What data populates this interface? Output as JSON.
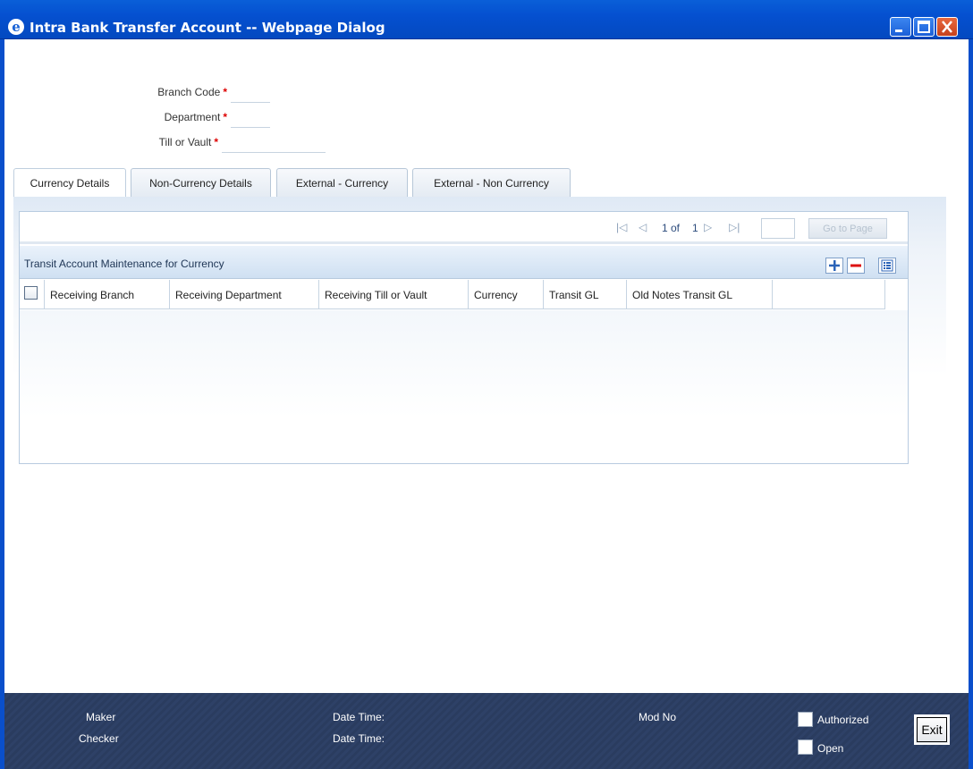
{
  "window": {
    "title": "Intra Bank Transfer Account -- Webpage Dialog"
  },
  "form": {
    "branch_code": {
      "label": "Branch Code",
      "required_mark": "*",
      "value": ""
    },
    "department": {
      "label": "Department",
      "required_mark": "*",
      "value": ""
    },
    "till_or_vault": {
      "label": "Till or Vault",
      "required_mark": "*",
      "value": ""
    }
  },
  "tabs": [
    {
      "label": "Currency Details",
      "active": true
    },
    {
      "label": "Non-Currency Details",
      "active": false
    },
    {
      "label": "External - Currency",
      "active": false
    },
    {
      "label": "External - Non Currency",
      "active": false
    }
  ],
  "pager": {
    "current": "1",
    "of_label": "of",
    "total": "1",
    "goto_label": "Go to Page",
    "goto_value": ""
  },
  "grid": {
    "title": "Transit Account Maintenance for Currency",
    "columns": [
      "Receiving Branch",
      "Receiving Department",
      "Receiving Till or Vault",
      "Currency",
      "Transit GL",
      "Old Notes Transit GL"
    ],
    "rows": []
  },
  "footer": {
    "maker_label": "Maker",
    "checker_label": "Checker",
    "date_time_label_1": "Date Time:",
    "date_time_label_2": "Date Time:",
    "mod_no_label": "Mod No",
    "authorized_label": "Authorized",
    "open_label": "Open",
    "exit_label": "Exit"
  },
  "colors": {
    "titlebar": "#0550d0",
    "required": "#dd0000",
    "footer": "#2a3c5f"
  }
}
